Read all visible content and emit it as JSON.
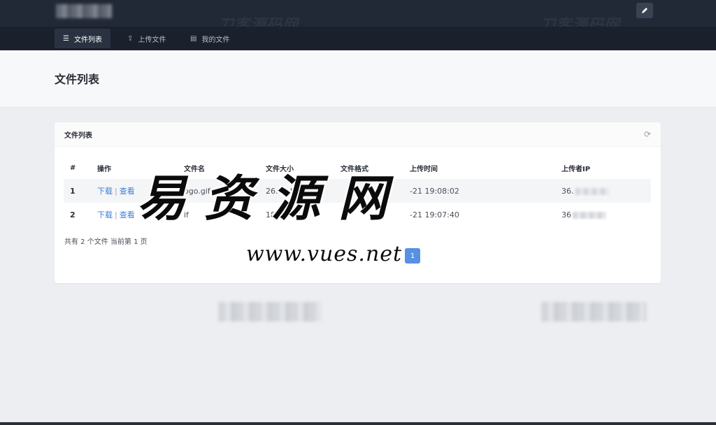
{
  "header": {
    "watermark_text": "刀客源码网",
    "edit_icon": "pen-icon"
  },
  "nav": {
    "items": [
      {
        "label": "文件列表",
        "icon": "list-icon",
        "active": true
      },
      {
        "label": "上传文件",
        "icon": "upload-icon",
        "active": false
      },
      {
        "label": "我的文件",
        "icon": "file-icon",
        "active": false
      }
    ]
  },
  "page": {
    "title": "文件列表"
  },
  "card": {
    "title": "文件列表",
    "refresh_icon": "refresh-icon",
    "columns": [
      "#",
      "操作",
      "文件名",
      "文件大小",
      "文件格式",
      "上传时间",
      "上传者IP"
    ],
    "rows": [
      {
        "num": "1",
        "download": "下载",
        "view": "查看",
        "filename": "ogo.gif",
        "size": "26.67 KB",
        "format": "",
        "time": "-21 19:08:02",
        "ip": "36."
      },
      {
        "num": "2",
        "download": "下载",
        "view": "查看",
        "filename": "if",
        "size": "18.01 KB",
        "format": "",
        "time": "-21 19:07:40",
        "ip": "36"
      }
    ],
    "summary": "共有 2 个文件  当前第 1 页",
    "current_page": "1"
  },
  "overlay": {
    "cn_text": "易资源网",
    "url_text": "www.vues.net"
  },
  "colors": {
    "header_bg": "#222936",
    "nav_bg": "#1b212c",
    "link": "#3b7ddd"
  }
}
